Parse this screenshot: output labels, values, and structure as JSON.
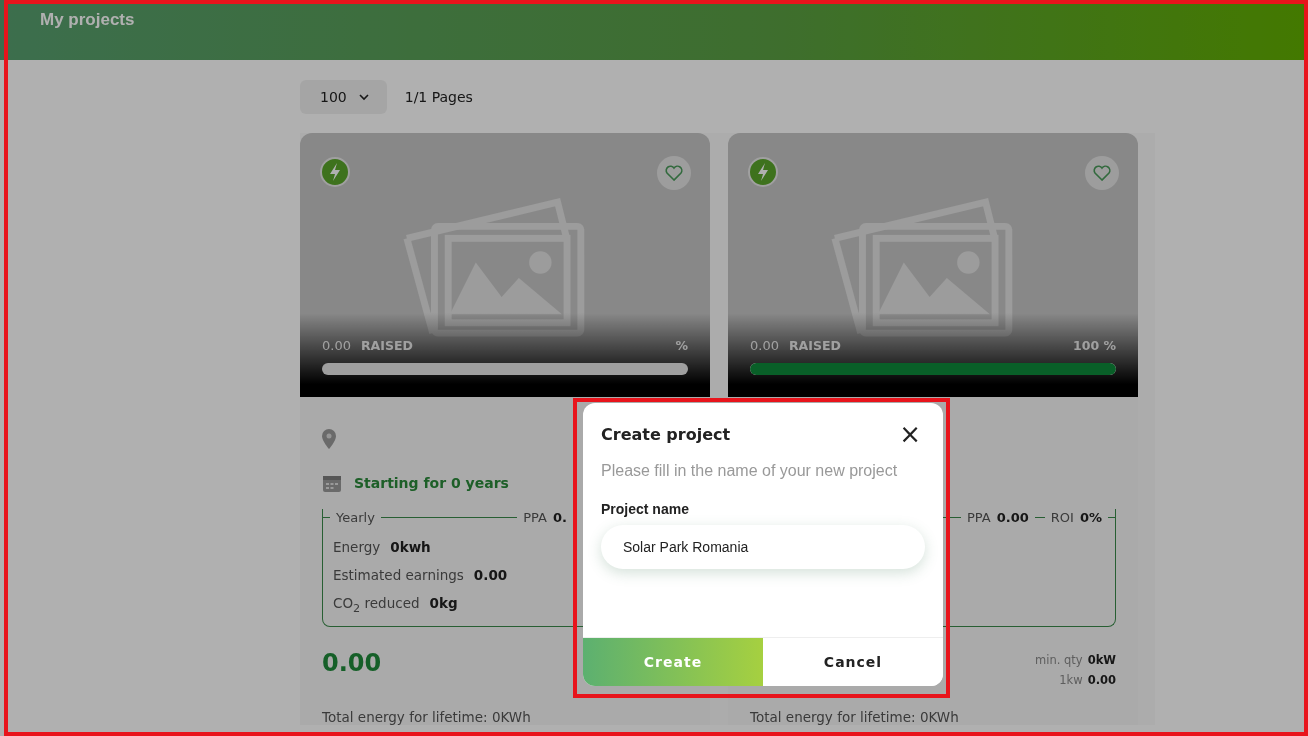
{
  "header": {
    "title": "My projects"
  },
  "pagination": {
    "page_size": "100",
    "pages": "1/1 Pages"
  },
  "cards": [
    {
      "raised": "0.00",
      "raised_label": "RAISED",
      "percent": "%",
      "level": 0,
      "start_text": "Starting for 0 years",
      "yearly_label": "Yearly",
      "ppa_label": "PPA",
      "ppa_value": "0.",
      "stats": [
        {
          "label": "Energy",
          "value": "0kwh"
        },
        {
          "label": "Estimated earnings",
          "value": "0.00"
        },
        {
          "label": "CO$_{2}$ reduced",
          "value": "0kg"
        }
      ],
      "price": "0.00",
      "total": "Total energy for lifetime: 0KWh"
    },
    {
      "raised": "0.00",
      "raised_label": "RAISED",
      "percent": "100 %",
      "level": 1,
      "ppa_label": "PPA",
      "ppa_value": "0.00",
      "roi_label": "ROI",
      "roi_value": "0%",
      "min_qty_label": "min. qty",
      "min_qty_value": "0kW",
      "kw_label": "1kw",
      "kw_value": "0.00",
      "total": "Total energy for lifetime: 0KWh"
    }
  ],
  "dialog": {
    "title": "Create project",
    "close": "×",
    "description": "Please fill in the name of your new project",
    "field_label": "Project name",
    "field_value": "Solar Park Romania",
    "buttons": [
      {
        "kind": "primary",
        "label": "Create"
      },
      {
        "kind": "secondary",
        "label": "Cancel"
      }
    ]
  }
}
